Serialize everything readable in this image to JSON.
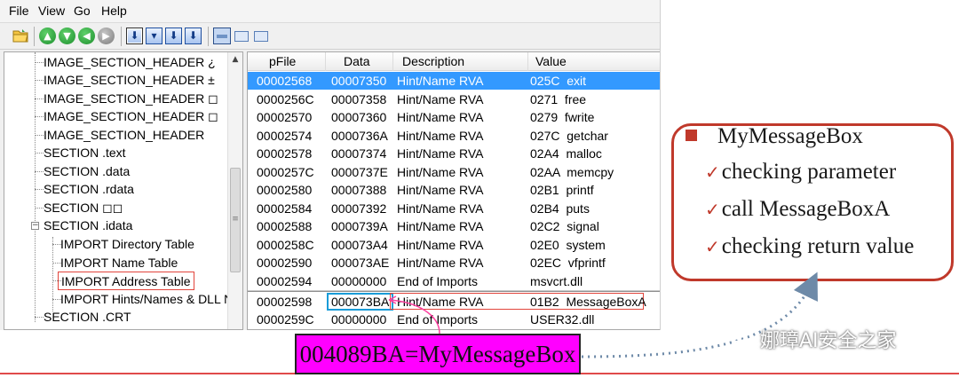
{
  "menu": {
    "file": "File",
    "view": "View",
    "go": "Go",
    "help": "Help"
  },
  "tree": {
    "items": [
      "IMAGE_SECTION_HEADER ¿",
      "IMAGE_SECTION_HEADER ±",
      "IMAGE_SECTION_HEADER ◻",
      "IMAGE_SECTION_HEADER ◻",
      "IMAGE_SECTION_HEADER",
      "SECTION .text",
      "SECTION .data",
      "SECTION .rdata",
      "SECTION ◻◻",
      "SECTION .idata",
      "IMPORT Directory Table",
      "IMPORT Name Table",
      "IMPORT Address Table",
      "IMPORT Hints/Names & DLL Nar",
      "SECTION .CRT"
    ]
  },
  "list": {
    "columns": [
      "pFile",
      "Data",
      "Description",
      "Value"
    ],
    "rows": [
      [
        "00002568",
        "00007350",
        "Hint/Name RVA",
        "025C  exit"
      ],
      [
        "0000256C",
        "00007358",
        "Hint/Name RVA",
        "0271  free"
      ],
      [
        "00002570",
        "00007360",
        "Hint/Name RVA",
        "0279  fwrite"
      ],
      [
        "00002574",
        "0000736A",
        "Hint/Name RVA",
        "027C  getchar"
      ],
      [
        "00002578",
        "00007374",
        "Hint/Name RVA",
        "02A4  malloc"
      ],
      [
        "0000257C",
        "0000737E",
        "Hint/Name RVA",
        "02AA  memcpy"
      ],
      [
        "00002580",
        "00007388",
        "Hint/Name RVA",
        "02B1  printf"
      ],
      [
        "00002584",
        "00007392",
        "Hint/Name RVA",
        "02B4  puts"
      ],
      [
        "00002588",
        "0000739A",
        "Hint/Name RVA",
        "02C2  signal"
      ],
      [
        "0000258C",
        "000073A4",
        "Hint/Name RVA",
        "02E0  system"
      ],
      [
        "00002590",
        "000073AE",
        "Hint/Name RVA",
        "02EC  vfprintf"
      ],
      [
        "00002594",
        "00000000",
        "End of Imports",
        "msvcrt.dll"
      ],
      [
        "00002598",
        "000073BA",
        "Hint/Name RVA",
        "01B2  MessageBoxA"
      ],
      [
        "0000259C",
        "00000000",
        "End of Imports",
        "USER32.dll"
      ]
    ]
  },
  "callout": {
    "title": "MyMessageBox",
    "lines": [
      "checking parameter",
      "call MessageBoxA",
      "checking return value"
    ]
  },
  "annotation": {
    "label": "004089BA=MyMessageBox"
  },
  "watermark": {
    "text": "娜璋AI安全之家"
  },
  "colors": {
    "selection": "#3399ff",
    "callout_border": "#c0392b",
    "annotation_fill": "#ff00ff",
    "data_highlight": "#1a9cd8"
  }
}
